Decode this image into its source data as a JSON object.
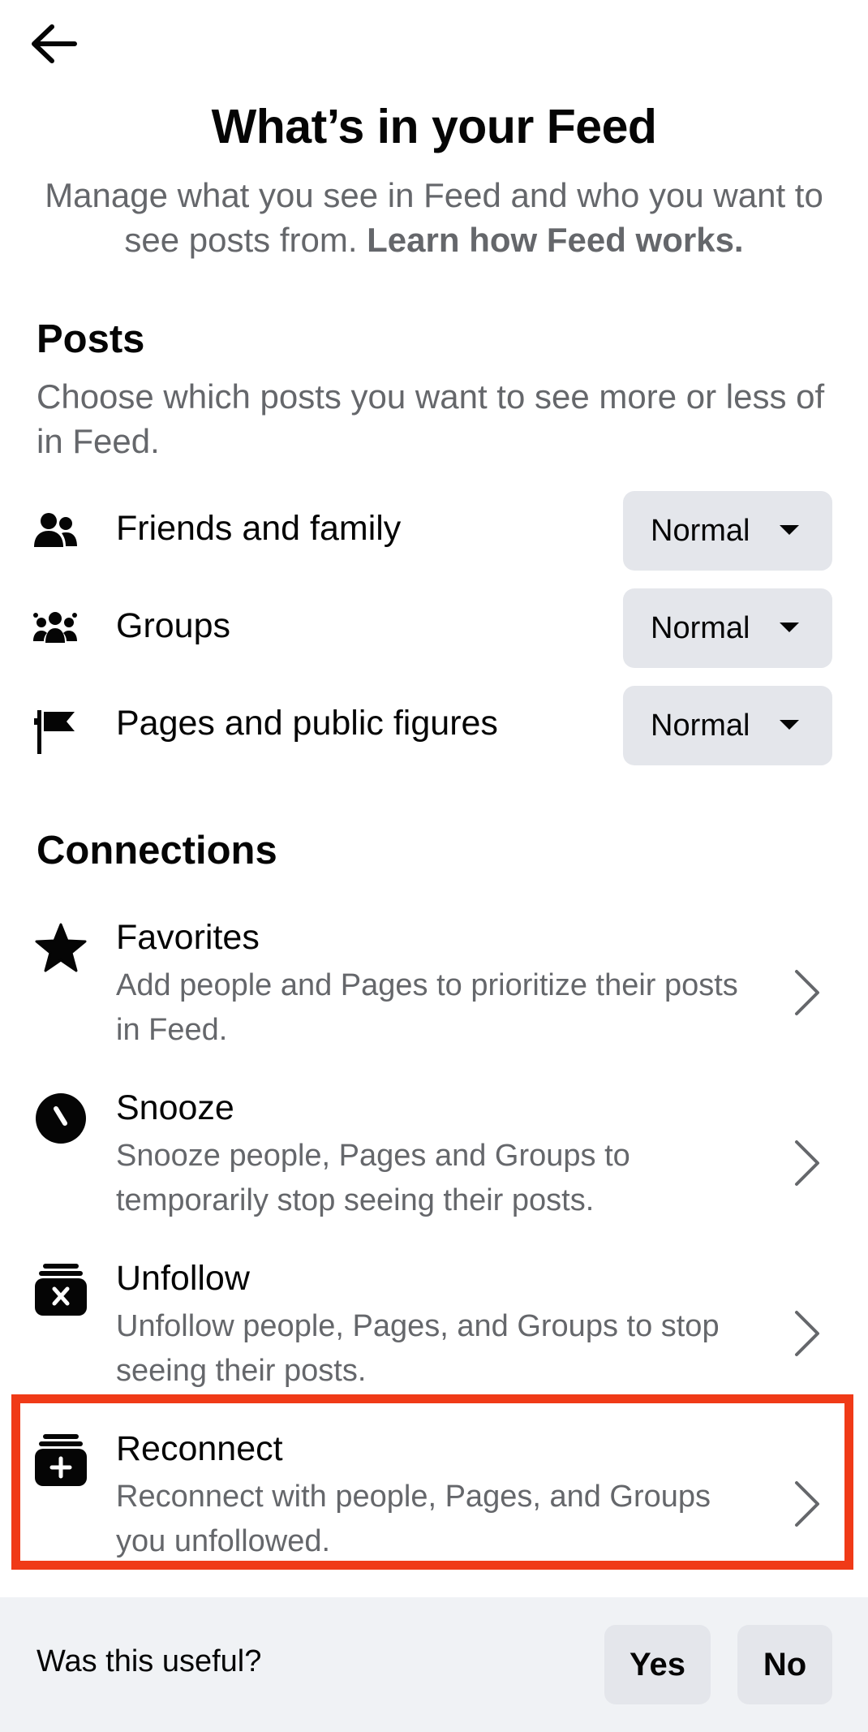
{
  "header": {
    "back_icon": "arrow-left-icon",
    "title": "What’s in your Feed",
    "subtitle": "Manage what you see in Feed and who you want to see posts from.",
    "learn_link": "Learn how Feed works."
  },
  "posts": {
    "title": "Posts",
    "description": "Choose which posts you want to see more or less of in Feed.",
    "items": [
      {
        "label": "Friends and family",
        "icon": "people-icon",
        "value": "Normal"
      },
      {
        "label": "Groups",
        "icon": "group-icon",
        "value": "Normal"
      },
      {
        "label": "Pages and public figures",
        "icon": "flag-icon",
        "value": "Normal"
      }
    ]
  },
  "connections": {
    "title": "Connections",
    "items": [
      {
        "title": "Favorites",
        "description": "Add people and Pages to prioritize their posts in Feed.",
        "icon": "star-icon"
      },
      {
        "title": "Snooze",
        "description": "Snooze people, Pages and Groups to temporarily stop seeing their posts.",
        "icon": "clock-icon"
      },
      {
        "title": "Unfollow",
        "description": "Unfollow people, Pages, and Groups to stop seeing their posts.",
        "icon": "unfollow-icon"
      },
      {
        "title": "Reconnect",
        "description": "Reconnect with people, Pages, and Groups you unfollowed.",
        "icon": "reconnect-icon"
      }
    ]
  },
  "feedback": {
    "question": "Was this useful?",
    "yes": "Yes",
    "no": "No"
  },
  "colors": {
    "highlight": "#f03a17",
    "secondary_text": "#65676b",
    "button_bg": "#e4e6eb",
    "footer_bg": "#f0f2f5"
  }
}
